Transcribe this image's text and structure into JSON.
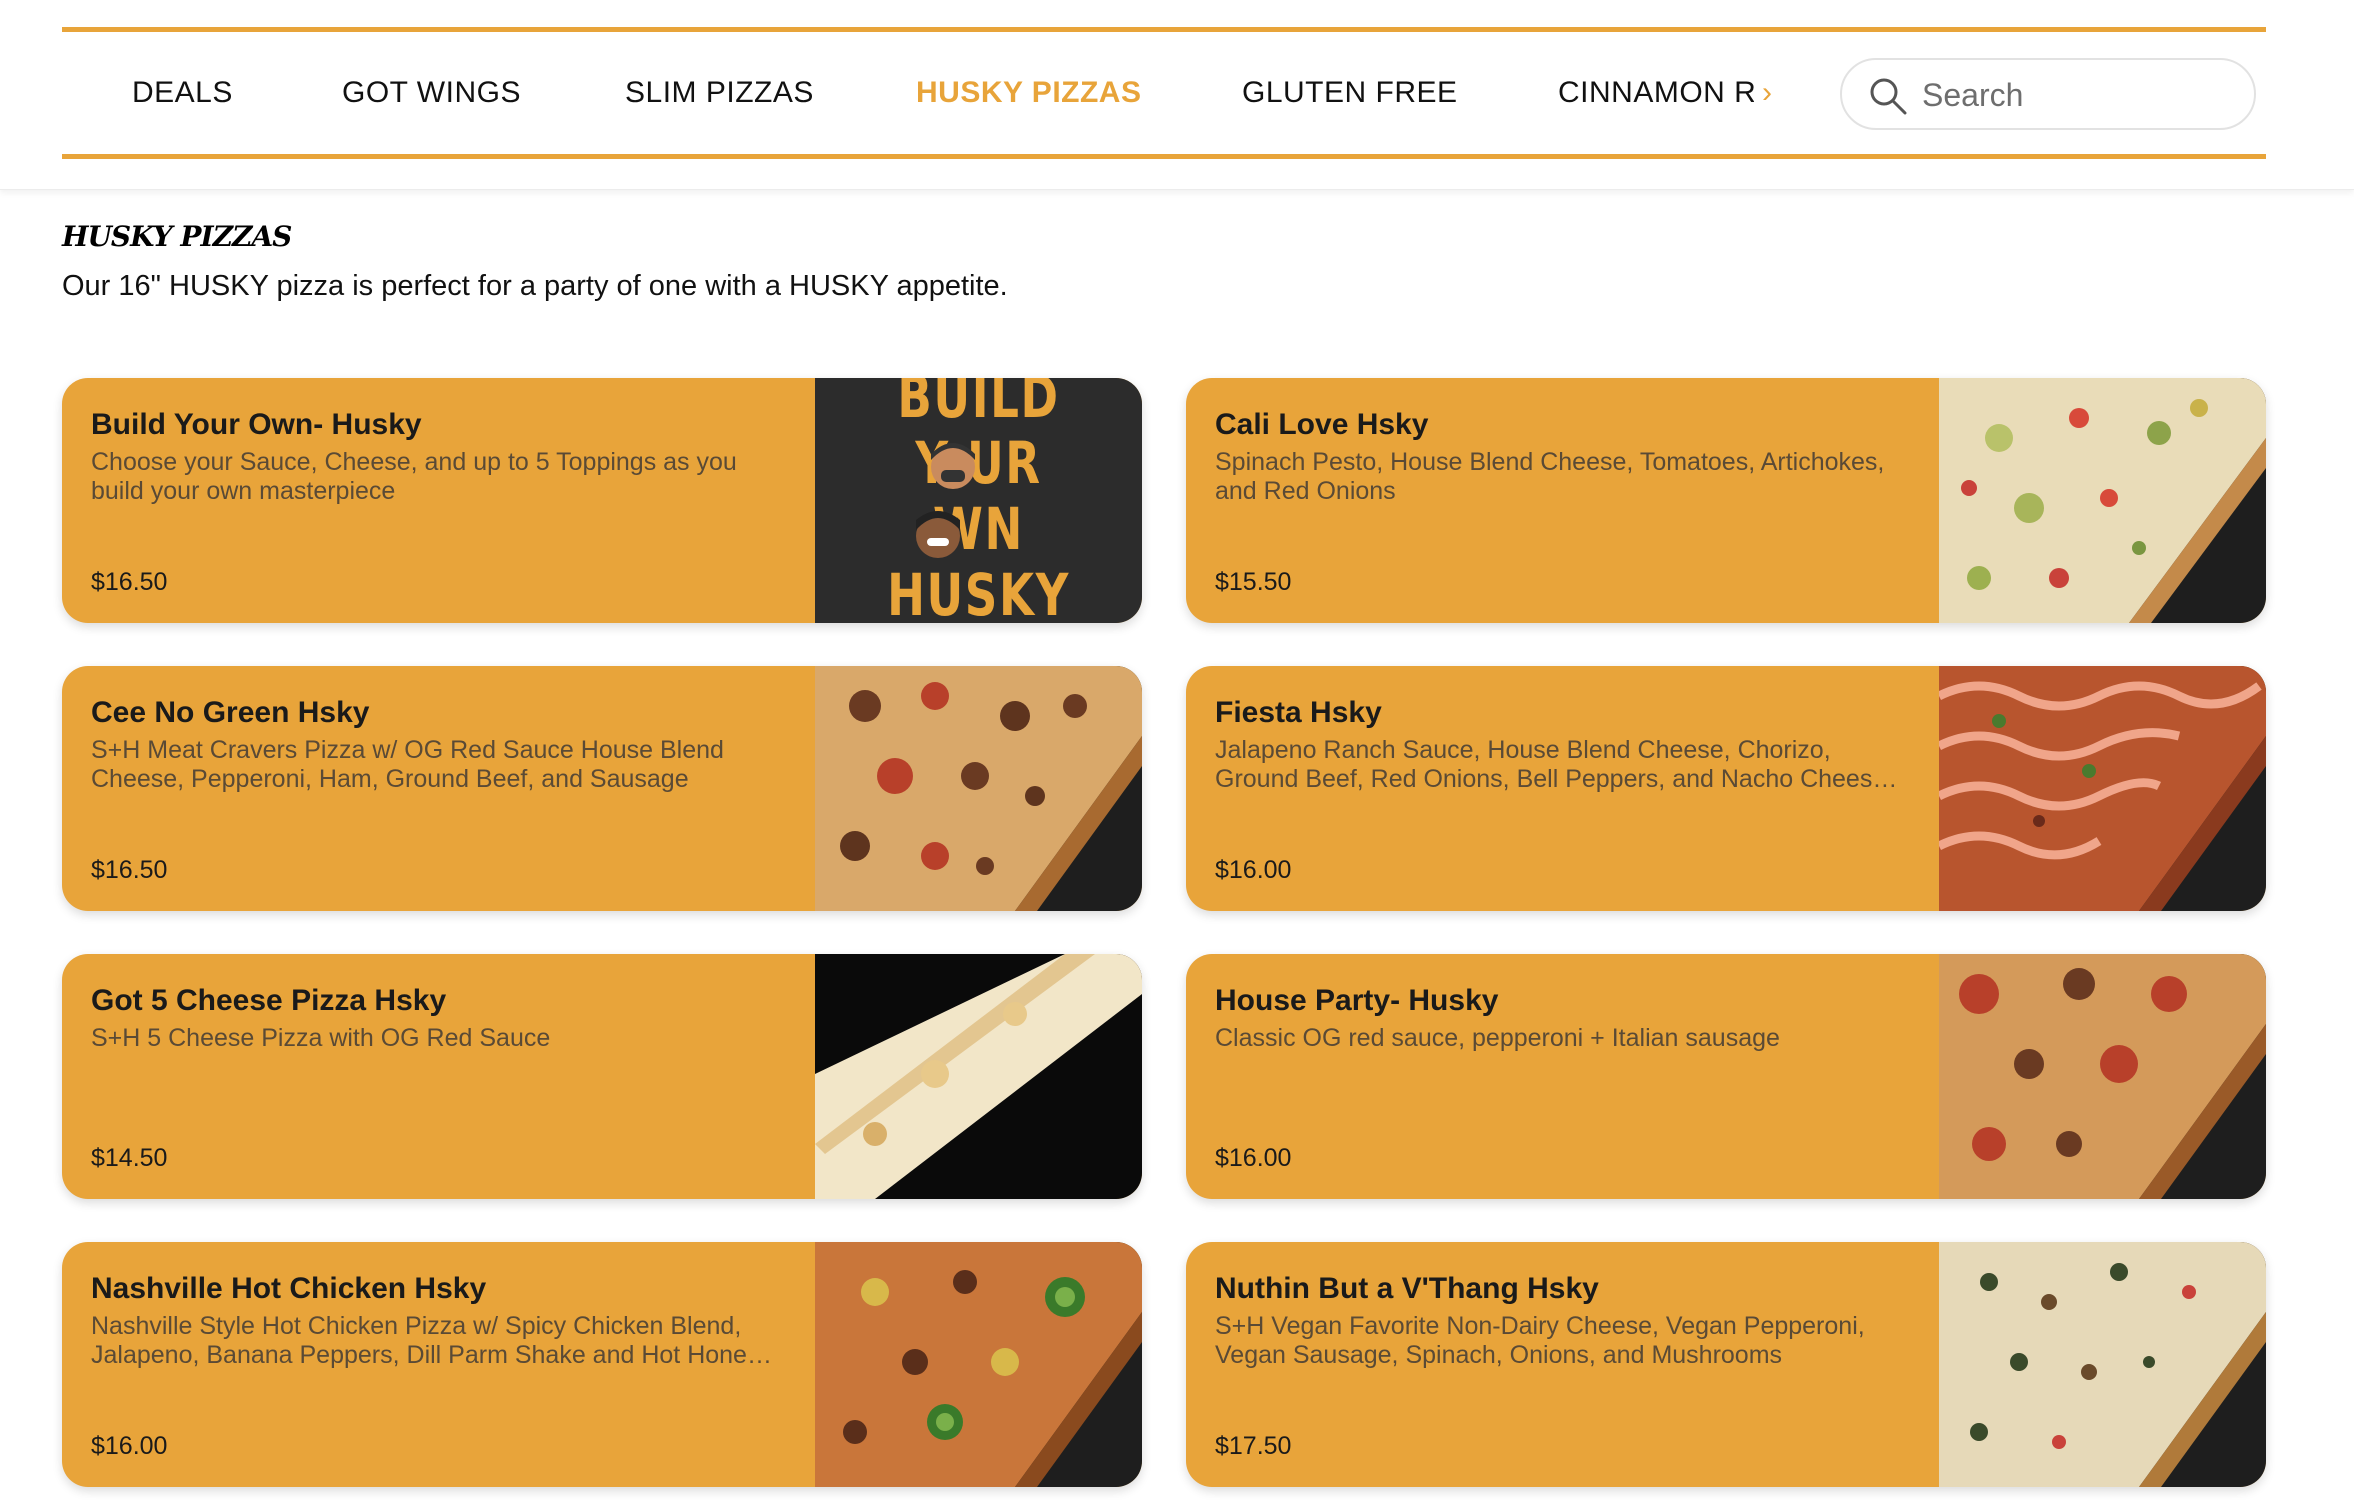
{
  "nav": {
    "items": [
      {
        "label": "DEALS",
        "active": false
      },
      {
        "label": "GOT WINGS",
        "active": false
      },
      {
        "label": "SLIM PIZZAS",
        "active": false
      },
      {
        "label": "HUSKY PIZZAS",
        "active": true
      },
      {
        "label": "GLUTEN FREE",
        "active": false
      },
      {
        "label": "CINNAMON ROLLS",
        "active": false
      }
    ],
    "next_icon": "chevron-right-icon",
    "accent_color": "#e8a43a"
  },
  "search": {
    "placeholder": "Search",
    "icon": "search-icon"
  },
  "section": {
    "title": "HUSKY PIZZAS",
    "description": "Our 16\" HUSKY pizza is perfect for a party of one with a HUSKY appetite."
  },
  "products": [
    {
      "name": "Build Your Own- Husky",
      "description": "Choose your Sauce, Cheese, and up to 5 Toppings as you build your own masterpiece",
      "price": "$16.50",
      "image_text": [
        "BUILD",
        "Y UR",
        " WN",
        "HUSKY"
      ]
    },
    {
      "name": "Cali Love Hsky",
      "description": "Spinach Pesto, House Blend Cheese, Tomatoes, Artichokes, and Red Onions",
      "price": "$15.50"
    },
    {
      "name": "Cee No Green Hsky",
      "description": "S+H Meat Cravers Pizza w/ OG Red Sauce House Blend Cheese, Pepperoni, Ham, Ground Beef, and Sausage",
      "price": "$16.50"
    },
    {
      "name": "Fiesta Hsky",
      "description": "Jalapeno Ranch Sauce, House Blend Cheese, Chorizo, Ground Beef, Red Onions, Bell Peppers, and Nacho Cheese Crumble",
      "price": "$16.00"
    },
    {
      "name": "Got 5 Cheese Pizza Hsky",
      "description": "S+H 5 Cheese Pizza with OG Red Sauce",
      "price": "$14.50"
    },
    {
      "name": "House Party- Husky",
      "description": "Classic OG red sauce, pepperoni + Italian sausage",
      "price": "$16.00"
    },
    {
      "name": "Nashville Hot Chicken Hsky",
      "description": "Nashville Style Hot Chicken Pizza w/ Spicy Chicken Blend, Jalapeno, Banana Peppers, Dill Parm Shake and Hot Honey Drizzle",
      "price": "$16.00"
    },
    {
      "name": "Nuthin But a V'Thang Hsky",
      "description": "S+H Vegan Favorite Non-Dairy Cheese, Vegan Pepperoni, Vegan Sausage, Spinach, Onions, and Mushrooms",
      "price": "$17.50"
    }
  ]
}
